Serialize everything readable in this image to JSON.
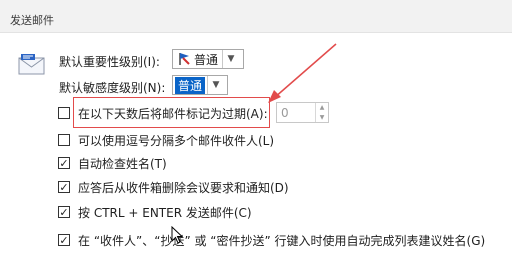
{
  "section": {
    "title": "发送邮件"
  },
  "icons": {
    "mail": "envelope-icon",
    "importance": "flag-icon",
    "cursor": "arrow-cursor-icon"
  },
  "importance": {
    "label": "默认重要性级别(I):",
    "value": "普通"
  },
  "sensitivity": {
    "label": "默认敏感度级别(N):",
    "value": "普通"
  },
  "options": [
    {
      "label": "在以下天数后将邮件标记为过期(A):",
      "checked": false
    },
    {
      "label": "可以使用逗号分隔多个邮件收件人(L)",
      "checked": false
    },
    {
      "label": "自动检查姓名(T)",
      "checked": true
    },
    {
      "label": "应答后从收件箱删除会议要求和通知(D)",
      "checked": true
    },
    {
      "label": "按 CTRL + ENTER 发送邮件(C)",
      "checked": true
    },
    {
      "label": "在 “收件人”、“抄送” 或 “密件抄送” 行键入时使用自动完成列表建议姓名(G)",
      "checked": true
    }
  ],
  "expire_days": {
    "value": "0"
  },
  "colors": {
    "annotation": "#e24b4b",
    "selection": "#0a64c8"
  }
}
